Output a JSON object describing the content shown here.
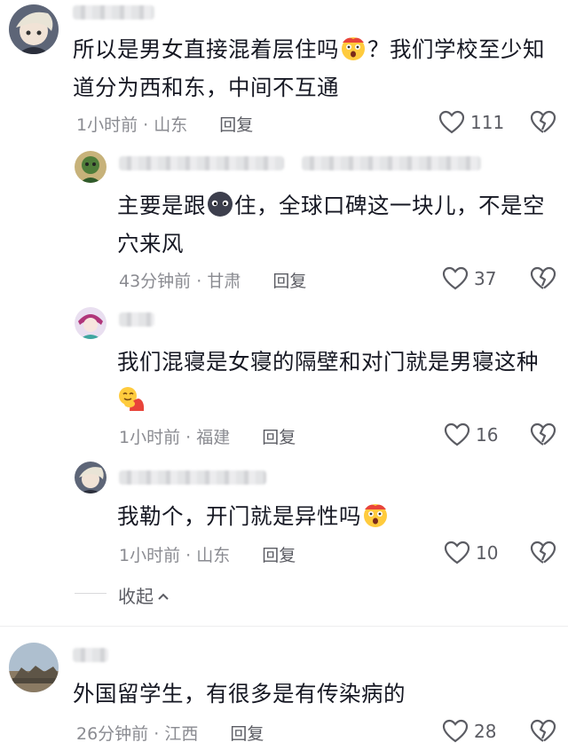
{
  "comments": [
    {
      "text_before": "所以是男女直接混着层住吗",
      "text_after": "？我们学校至少知道分为西和东，中间不互通",
      "time": "1小时前",
      "location": "山东",
      "reply_label": "回复",
      "likes": "111",
      "emoji_icon": "astonished-emoji-icon"
    },
    {
      "text_before": "主要是跟",
      "text_after": "住，全球口碑这一块儿，不是空穴来风",
      "time": "43分钟前",
      "location": "甘肃",
      "reply_label": "回复",
      "likes": "37",
      "emoji_icon": "dark-blob-emoji-icon"
    },
    {
      "text_before": "我们混寝是女寝的隔壁和对门就是男寝这种",
      "text_after": "",
      "time": "1小时前",
      "location": "福建",
      "reply_label": "回复",
      "likes": "16",
      "emoji_icon": "hug-emoji-icon"
    },
    {
      "text_before": "我勒个，开门就是异性吗",
      "text_after": "",
      "time": "1小时前",
      "location": "山东",
      "reply_label": "回复",
      "likes": "10",
      "emoji_icon": "astonished-emoji-icon"
    },
    {
      "text_before": "外国留学生，有很多是有传染病的",
      "text_after": "",
      "time": "26分钟前",
      "location": "江西",
      "reply_label": "回复",
      "likes": "28"
    }
  ],
  "collapse_label": "收起",
  "meta_separator": "·",
  "colors": {
    "text": "#161823",
    "meta": "#8a8b91",
    "icon": "#5b5c63"
  }
}
